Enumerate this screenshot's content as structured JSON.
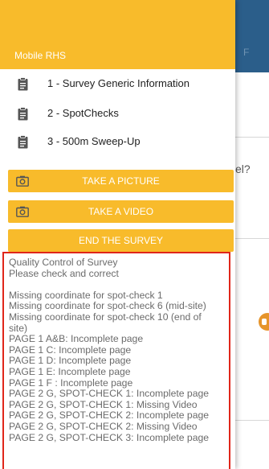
{
  "app": {
    "title": "Mobile RHS",
    "behind_bar_text": "F",
    "behind_text": "el?"
  },
  "menu": {
    "items": [
      {
        "label": "1 - Survey Generic Information",
        "icon": "clipboard-icon"
      },
      {
        "label": "2 - SpotChecks",
        "icon": "clipboard-icon"
      },
      {
        "label": "3 - 500m Sweep-Up",
        "icon": "clipboard-icon"
      }
    ]
  },
  "actions": {
    "take_picture": "TAKE A PICTURE",
    "take_video": "TAKE A VIDEO",
    "end_survey": "END THE SURVEY"
  },
  "qc": {
    "title": "Quality Control of Survey",
    "subtitle": "Please check and correct",
    "lines": [
      "Missing coordinate for spot-check 1",
      "Missing coordinate for spot-check 6 (mid-site)",
      "Missing coordinate for spot-check 10 (end of",
      "site)",
      "PAGE 1 A&B: Incomplete page",
      "PAGE 1 C: Incomplete page",
      "PAGE 1 D: Incomplete page",
      "PAGE 1 E: Incomplete page",
      "PAGE 1 F : Incomplete page",
      "PAGE 2 G, SPOT-CHECK 1: Incomplete page",
      "PAGE 2 G, SPOT-CHECK 1: Missing Video",
      "PAGE 2 G, SPOT-CHECK 2: Incomplete page",
      "PAGE 2 G, SPOT-CHECK 2: Missing Video",
      "PAGE 2 G, SPOT-CHECK 3: Incomplete page"
    ]
  },
  "colors": {
    "accent": "#f8bb2b",
    "appbar": "#2b5e8a",
    "highlight_border": "#e0261a"
  }
}
